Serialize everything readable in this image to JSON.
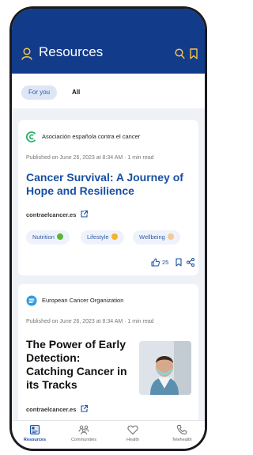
{
  "header": {
    "title": "Resources"
  },
  "tabs": [
    {
      "label": "For you",
      "active": true
    },
    {
      "label": "All",
      "active": false
    }
  ],
  "articles": [
    {
      "source": "Asociación española contra el cancer",
      "source_icon": "aecc-logo",
      "meta": "Published on June 26, 2023 at 8:34 AM · 1 min read",
      "title": "Cancer Survival: A Journey of Hope and Resilience",
      "link": "contraelcancer.es",
      "tags": [
        {
          "label": "Nutrition",
          "emoji_color": "#5db33a"
        },
        {
          "label": "Lifestyle",
          "emoji_color": "#f2b233"
        },
        {
          "label": "Wellbeing",
          "emoji_color": "#f3c99a"
        }
      ],
      "likes": "25"
    },
    {
      "source": "European Cancer Organization",
      "source_icon": "eco-logo",
      "meta": "Published on June 26, 2023 at 8:34 AM · 1 min read",
      "title": "The Power of Early Detection: Catching Cancer in its Tracks",
      "link": "contraelcancer.es"
    }
  ],
  "bottom_nav": [
    {
      "label": "Resources",
      "icon": "resources-icon",
      "active": true
    },
    {
      "label": "Communities",
      "icon": "communities-icon",
      "active": false
    },
    {
      "label": "Health",
      "icon": "heart-icon",
      "active": false
    },
    {
      "label": "Telehealth",
      "icon": "phone-icon",
      "active": false
    }
  ],
  "colors": {
    "header_bg": "#123b8a",
    "accent_yellow": "#f6c54a",
    "link_blue": "#174fa3"
  }
}
